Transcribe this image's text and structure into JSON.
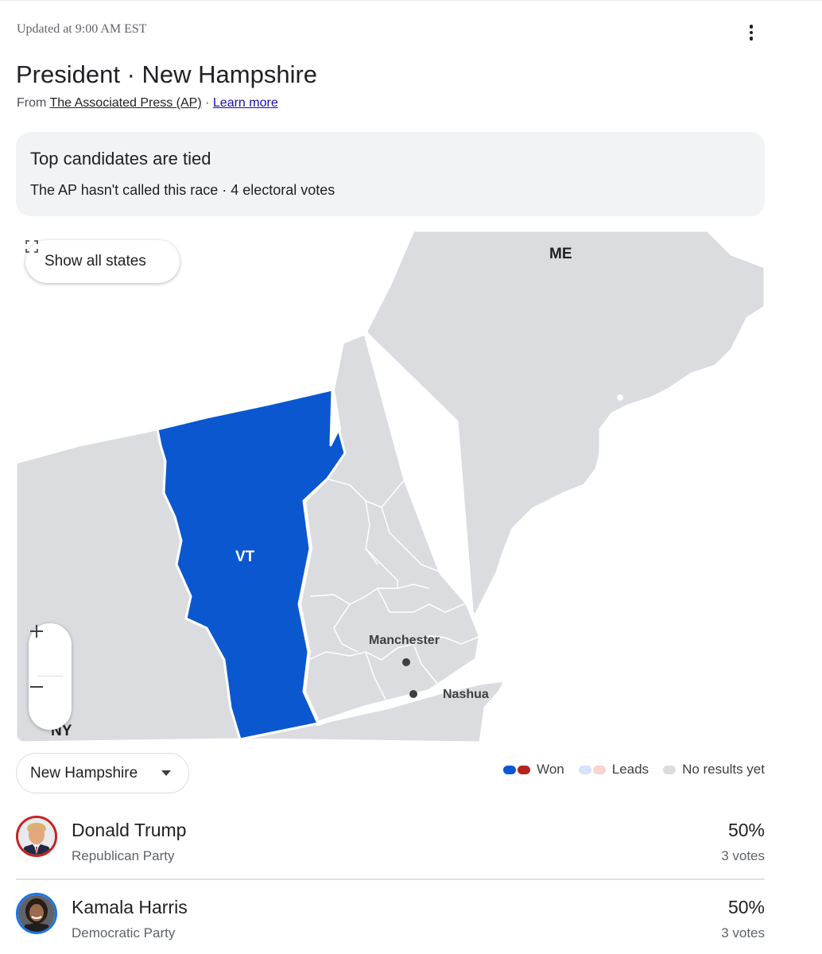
{
  "header": {
    "updated": "Updated at 9:00 AM EST",
    "more_icon": "more-vert-icon",
    "title": "President · New Hampshire",
    "source_prefix": "From",
    "source_link": "The Associated Press (AP)",
    "source_separator": "·",
    "learn_more": "Learn more"
  },
  "status": {
    "heading": "Top candidates are tied",
    "subtext": "The AP hasn't called this race · 4 electoral votes"
  },
  "map": {
    "show_all_label": "Show all states",
    "show_all_icon": "expand-icon",
    "zoom_in_icon": "plus-icon",
    "zoom_out_icon": "minus-icon",
    "labels": {
      "me": "ME",
      "vt": "VT",
      "ny": "NY",
      "manchester": "Manchester",
      "nashua": "Nashua"
    },
    "colors": {
      "vt_fill": "#0b57d0",
      "state_fill": "#dadce0",
      "border": "#ffffff"
    }
  },
  "selector": {
    "value": "New Hampshire",
    "icon": "caret-down-icon"
  },
  "legend": {
    "won": "Won",
    "leads": "Leads",
    "no_results": "No results yet",
    "colors": {
      "won_dem": "#0b57d0",
      "won_rep": "#b3261e",
      "leads_dem": "#d3e3fd",
      "leads_rep": "#fad2cf",
      "no_results": "#dadce0"
    }
  },
  "candidates": [
    {
      "name": "Donald Trump",
      "party": "Republican Party",
      "percent": "50%",
      "votes": "3 votes",
      "color": "#c5221f"
    },
    {
      "name": "Kamala Harris",
      "party": "Democratic Party",
      "percent": "50%",
      "votes": "3 votes",
      "color": "#1a73e8"
    }
  ]
}
